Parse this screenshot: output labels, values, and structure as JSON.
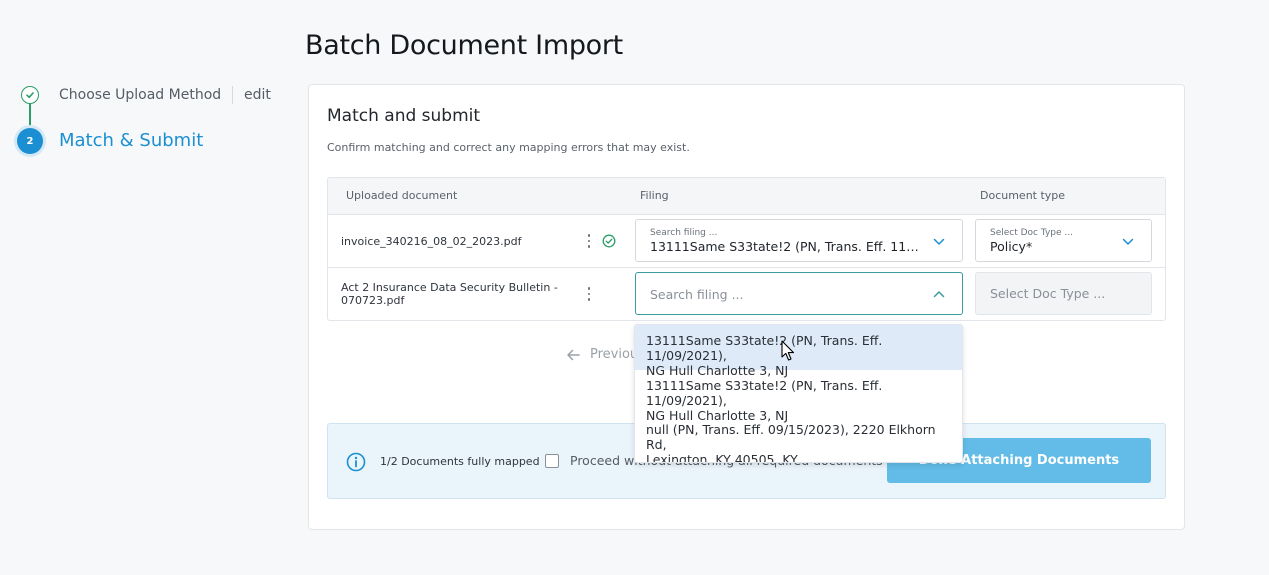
{
  "page_title": "Batch Document Import",
  "stepper": {
    "steps": [
      {
        "label": "Choose Upload Method",
        "status": "done",
        "edit_label": "edit"
      },
      {
        "number": "2",
        "label": "Match & Submit",
        "status": "current"
      }
    ]
  },
  "card": {
    "title": "Match and submit",
    "subtitle": "Confirm matching and correct any mapping errors that may exist.",
    "columns": [
      "Uploaded document",
      "Filing",
      "Document type"
    ],
    "rows": [
      {
        "document": "invoice_340216_08_02_2023.pdf",
        "filing_label": "Search filing ...",
        "filing_value": "13111Same S33tate!2 (PN, Trans. Eff. 11/09/2021), NG Hull Charlotte 3, NJ",
        "doctype_label": "Select Doc Type ...",
        "doctype_value": "Policy*"
      },
      {
        "document": "Act 2 Insurance Data Security Bulletin - 070723.pdf",
        "filing_placeholder": "Search filing ...",
        "doctype_placeholder": "Select Doc Type ..."
      }
    ],
    "previous_label": "Previous",
    "footer": {
      "mapped_text": "1/2 Documents fully mapped",
      "proceed_label": "Proceed without attaching all required documents",
      "done_label": "Done Attaching Documents"
    }
  },
  "dropdown": {
    "items": [
      {
        "line1": "13111Same S33tate!2 (PN, Trans. Eff. 11/09/2021),",
        "line2": "NG Hull Charlotte 3, NJ"
      },
      {
        "line1": "13111Same S33tate!2 (PN, Trans. Eff. 11/09/2021),",
        "line2": "NG Hull Charlotte 3, NJ"
      },
      {
        "line1": "null (PN, Trans. Eff. 09/15/2023), 2220 Elkhorn Rd,",
        "line2": "Lexington, KY 40505, KY"
      }
    ]
  },
  "colors": {
    "accent": "#1b8fd1",
    "success": "#2a9d68",
    "button": "#62bce7",
    "focus": "#3a9aa2"
  }
}
